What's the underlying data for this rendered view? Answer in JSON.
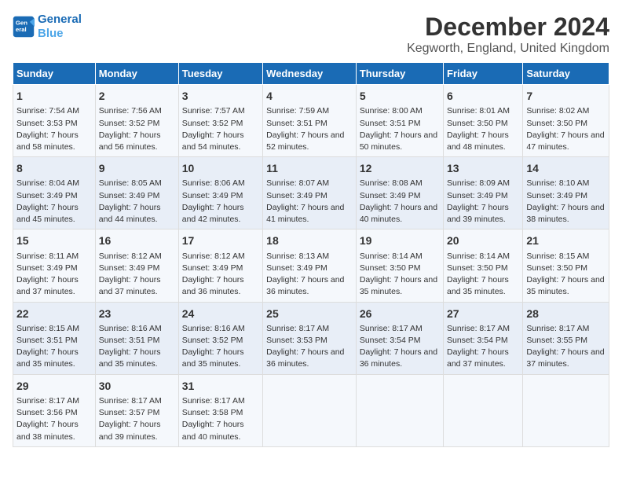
{
  "header": {
    "logo_line1": "General",
    "logo_line2": "Blue",
    "title": "December 2024",
    "subtitle": "Kegworth, England, United Kingdom"
  },
  "columns": [
    "Sunday",
    "Monday",
    "Tuesday",
    "Wednesday",
    "Thursday",
    "Friday",
    "Saturday"
  ],
  "weeks": [
    [
      {
        "day": 1,
        "rise": "7:54 AM",
        "set": "3:53 PM",
        "hours": "7 hours and 58 minutes."
      },
      {
        "day": 2,
        "rise": "7:56 AM",
        "set": "3:52 PM",
        "hours": "7 hours and 56 minutes."
      },
      {
        "day": 3,
        "rise": "7:57 AM",
        "set": "3:52 PM",
        "hours": "7 hours and 54 minutes."
      },
      {
        "day": 4,
        "rise": "7:59 AM",
        "set": "3:51 PM",
        "hours": "7 hours and 52 minutes."
      },
      {
        "day": 5,
        "rise": "8:00 AM",
        "set": "3:51 PM",
        "hours": "7 hours and 50 minutes."
      },
      {
        "day": 6,
        "rise": "8:01 AM",
        "set": "3:50 PM",
        "hours": "7 hours and 48 minutes."
      },
      {
        "day": 7,
        "rise": "8:02 AM",
        "set": "3:50 PM",
        "hours": "7 hours and 47 minutes."
      }
    ],
    [
      {
        "day": 8,
        "rise": "8:04 AM",
        "set": "3:49 PM",
        "hours": "7 hours and 45 minutes."
      },
      {
        "day": 9,
        "rise": "8:05 AM",
        "set": "3:49 PM",
        "hours": "7 hours and 44 minutes."
      },
      {
        "day": 10,
        "rise": "8:06 AM",
        "set": "3:49 PM",
        "hours": "7 hours and 42 minutes."
      },
      {
        "day": 11,
        "rise": "8:07 AM",
        "set": "3:49 PM",
        "hours": "7 hours and 41 minutes."
      },
      {
        "day": 12,
        "rise": "8:08 AM",
        "set": "3:49 PM",
        "hours": "7 hours and 40 minutes."
      },
      {
        "day": 13,
        "rise": "8:09 AM",
        "set": "3:49 PM",
        "hours": "7 hours and 39 minutes."
      },
      {
        "day": 14,
        "rise": "8:10 AM",
        "set": "3:49 PM",
        "hours": "7 hours and 38 minutes."
      }
    ],
    [
      {
        "day": 15,
        "rise": "8:11 AM",
        "set": "3:49 PM",
        "hours": "7 hours and 37 minutes."
      },
      {
        "day": 16,
        "rise": "8:12 AM",
        "set": "3:49 PM",
        "hours": "7 hours and 37 minutes."
      },
      {
        "day": 17,
        "rise": "8:12 AM",
        "set": "3:49 PM",
        "hours": "7 hours and 36 minutes."
      },
      {
        "day": 18,
        "rise": "8:13 AM",
        "set": "3:49 PM",
        "hours": "7 hours and 36 minutes."
      },
      {
        "day": 19,
        "rise": "8:14 AM",
        "set": "3:50 PM",
        "hours": "7 hours and 35 minutes."
      },
      {
        "day": 20,
        "rise": "8:14 AM",
        "set": "3:50 PM",
        "hours": "7 hours and 35 minutes."
      },
      {
        "day": 21,
        "rise": "8:15 AM",
        "set": "3:50 PM",
        "hours": "7 hours and 35 minutes."
      }
    ],
    [
      {
        "day": 22,
        "rise": "8:15 AM",
        "set": "3:51 PM",
        "hours": "7 hours and 35 minutes."
      },
      {
        "day": 23,
        "rise": "8:16 AM",
        "set": "3:51 PM",
        "hours": "7 hours and 35 minutes."
      },
      {
        "day": 24,
        "rise": "8:16 AM",
        "set": "3:52 PM",
        "hours": "7 hours and 35 minutes."
      },
      {
        "day": 25,
        "rise": "8:17 AM",
        "set": "3:53 PM",
        "hours": "7 hours and 36 minutes."
      },
      {
        "day": 26,
        "rise": "8:17 AM",
        "set": "3:54 PM",
        "hours": "7 hours and 36 minutes."
      },
      {
        "day": 27,
        "rise": "8:17 AM",
        "set": "3:54 PM",
        "hours": "7 hours and 37 minutes."
      },
      {
        "day": 28,
        "rise": "8:17 AM",
        "set": "3:55 PM",
        "hours": "7 hours and 37 minutes."
      }
    ],
    [
      {
        "day": 29,
        "rise": "8:17 AM",
        "set": "3:56 PM",
        "hours": "7 hours and 38 minutes."
      },
      {
        "day": 30,
        "rise": "8:17 AM",
        "set": "3:57 PM",
        "hours": "7 hours and 39 minutes."
      },
      {
        "day": 31,
        "rise": "8:17 AM",
        "set": "3:58 PM",
        "hours": "7 hours and 40 minutes."
      },
      null,
      null,
      null,
      null
    ]
  ]
}
